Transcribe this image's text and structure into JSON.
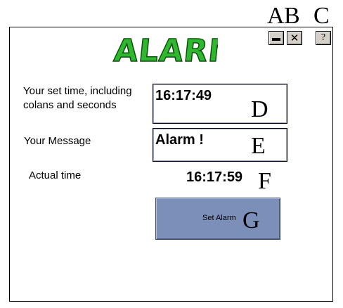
{
  "app": {
    "logo_text": "ALARM"
  },
  "callouts": {
    "a": "A",
    "b": "B",
    "c": "C",
    "d": "D",
    "e": "E",
    "f": "F",
    "g": "G"
  },
  "titlebar": {
    "minimize_icon": "minimize-icon",
    "close_icon": "close-icon",
    "close_glyph": "✕",
    "help_icon": "help-icon",
    "help_glyph": "?"
  },
  "form": {
    "set_time_label_line1": "Your set time, including",
    "set_time_label_line2": "colans and seconds",
    "set_time_value": "16:17:49",
    "message_label": "Your Message",
    "message_value": "Alarm !",
    "actual_time_label": "Actual time",
    "actual_time_value": "16:17:59",
    "set_alarm_button": "Set Alarm"
  },
  "colors": {
    "logo_fill": "#2fb82f",
    "button_bg": "#7b8fb9",
    "field_border": "#7a86b8"
  }
}
